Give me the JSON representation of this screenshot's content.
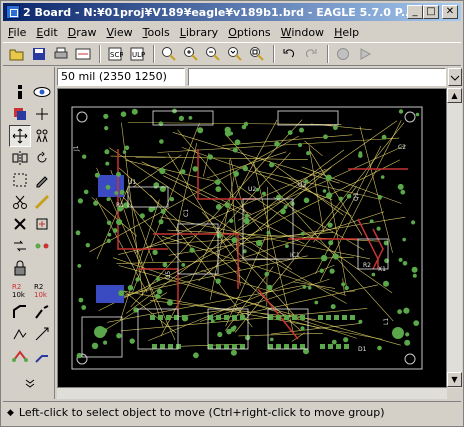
{
  "window": {
    "title": "2 Board - N:¥01proj¥V189¥eagle¥v189b1.brd - EAGLE 5.7.0 P...",
    "minimize": "_",
    "maximize": "□",
    "close": "✕"
  },
  "menu": [
    {
      "label": "File",
      "u": "F",
      "rest": "ile"
    },
    {
      "label": "Edit",
      "u": "E",
      "rest": "dit"
    },
    {
      "label": "Draw",
      "u": "D",
      "rest": "raw"
    },
    {
      "label": "View",
      "u": "V",
      "rest": "iew"
    },
    {
      "label": "Tools",
      "u": "T",
      "rest": "ools"
    },
    {
      "label": "Library",
      "u": "L",
      "rest": "ibrary"
    },
    {
      "label": "Options",
      "u": "O",
      "rest": "ptions"
    },
    {
      "label": "Window",
      "u": "W",
      "rest": "indow"
    },
    {
      "label": "Help",
      "u": "H",
      "rest": "elp"
    }
  ],
  "coordinates": "50 mil (2350 1250)",
  "command_input": "",
  "status": "Left-click to select object to move (Ctrl+right-click to move group)",
  "board_labels": [
    "J1",
    "U1",
    "R1",
    "C1",
    "U2",
    "U3",
    "Q1",
    "C2",
    "R2",
    "U5",
    "IC1",
    "X1",
    "L1",
    "D1"
  ],
  "icons": {
    "open": "folder-open-icon",
    "save": "save-icon",
    "print": "print-icon",
    "zoom_in": "zoom-in-icon",
    "zoom_out": "zoom-out-icon",
    "undo": "undo-icon",
    "redo": "redo-icon",
    "move": "move-icon"
  },
  "colors": {
    "canvas": "#000000",
    "board_outline": "#c8c8c8",
    "pads": "#5aa84a",
    "airwires": "#e6d66a",
    "top_copper": "#c83232",
    "bottom_copper": "#3a4ac0",
    "silkscreen": "#e8e8e8"
  }
}
